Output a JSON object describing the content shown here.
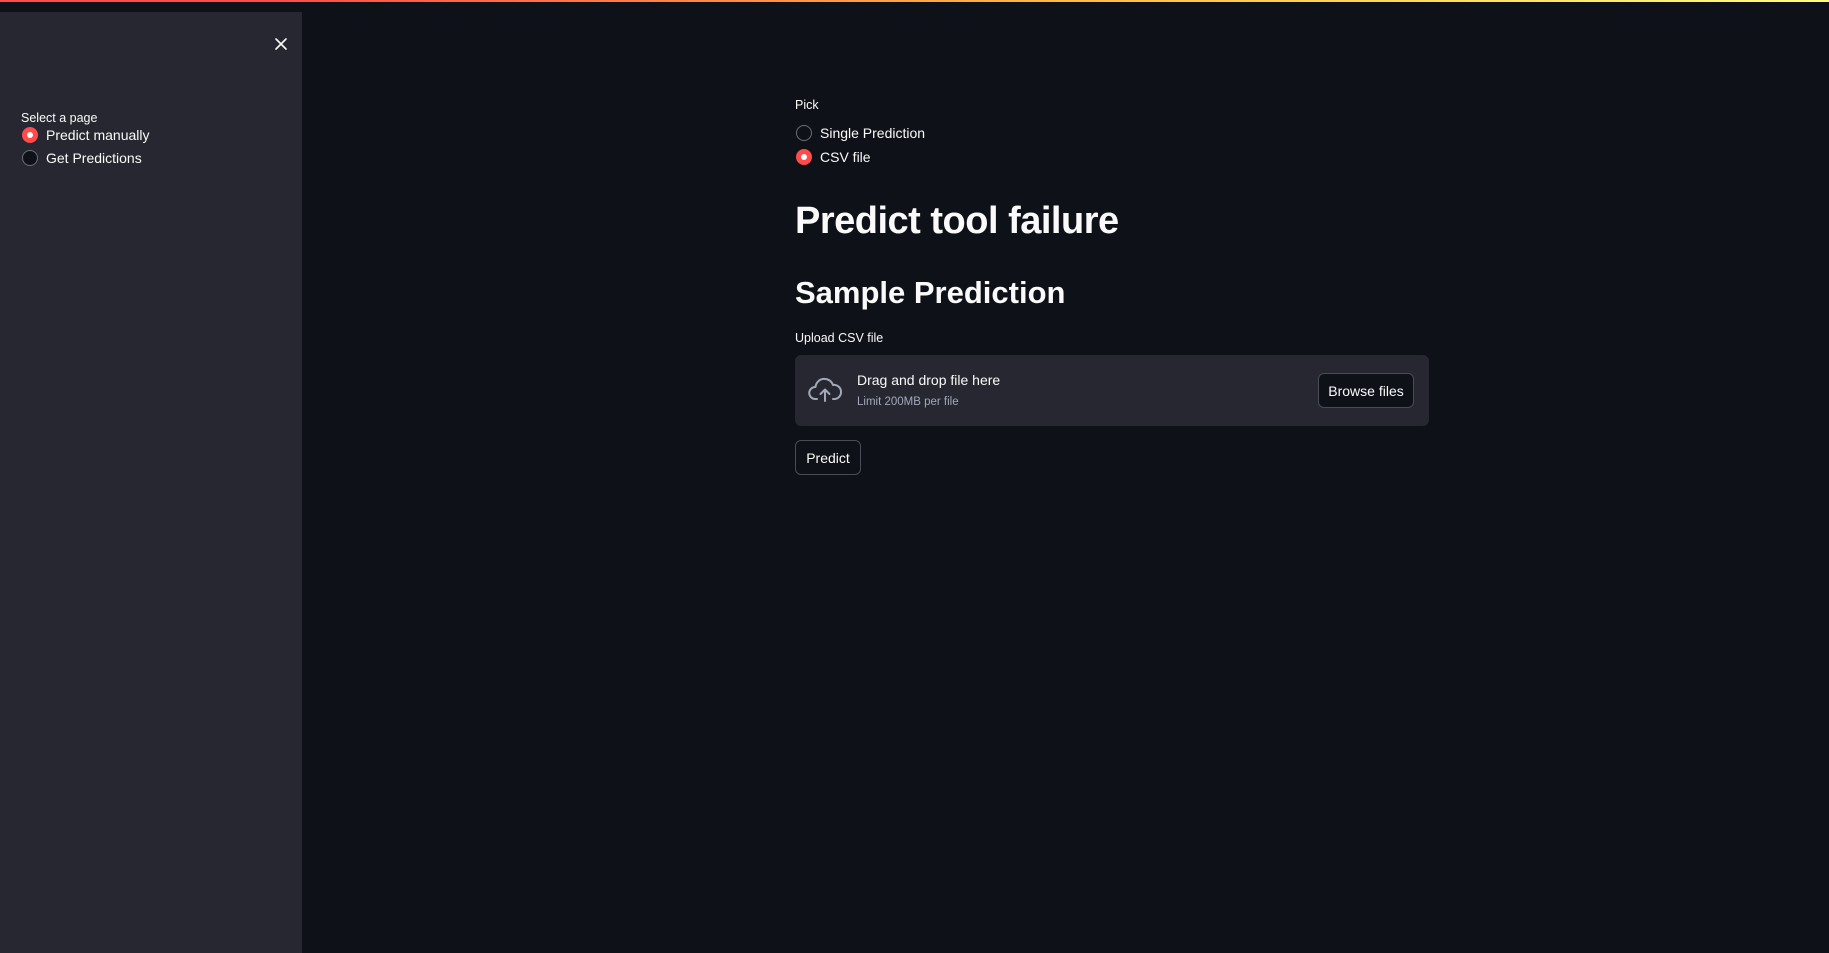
{
  "sidebar": {
    "label": "Select a page",
    "options": [
      {
        "label": "Predict manually",
        "selected": true
      },
      {
        "label": "Get Predictions",
        "selected": false
      }
    ],
    "close_icon": "close-icon"
  },
  "main": {
    "pick_label": "Pick",
    "pick_options": [
      {
        "label": "Single Prediction",
        "selected": false
      },
      {
        "label": "CSV file",
        "selected": true
      }
    ],
    "title": "Predict tool failure",
    "subtitle": "Sample Prediction",
    "upload": {
      "label": "Upload CSV file",
      "drop_text": "Drag and drop file here",
      "limit_text": "Limit 200MB per file",
      "browse_label": "Browse files",
      "icon": "cloud-upload-icon"
    },
    "predict_label": "Predict"
  },
  "colors": {
    "background": "#0e1117",
    "sidebar": "#262730",
    "accent": "#ff4b4b",
    "text": "#fafafa"
  }
}
